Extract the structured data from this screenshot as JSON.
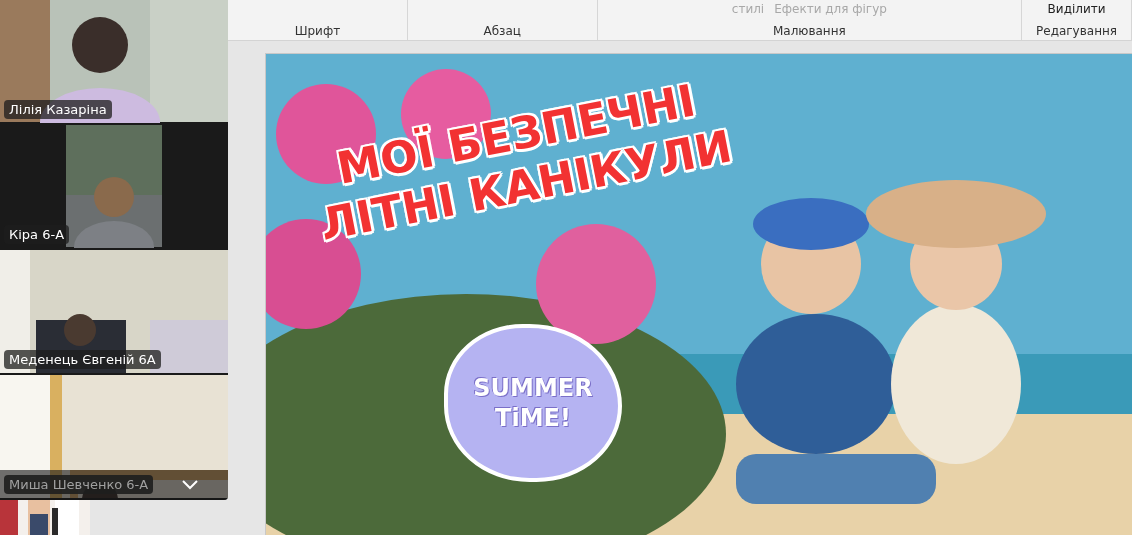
{
  "video_tiles": [
    {
      "name": "Лілія Казаріна",
      "kind": "wide",
      "dimmed": false
    },
    {
      "name": "Кіра 6-А",
      "kind": "narrow",
      "dimmed": false
    },
    {
      "name": "Меденець Євгеній 6А",
      "kind": "wide",
      "dimmed": false
    },
    {
      "name": "Миша Шевченко 6-А",
      "kind": "wide",
      "dimmed": true
    }
  ],
  "ribbon": {
    "groups": [
      {
        "label": "Шрифт"
      },
      {
        "label": "Абзац"
      },
      {
        "label": "Малювання",
        "items": [
          "стилі",
          "Ефекти для фігур"
        ]
      },
      {
        "label": "Редагування",
        "items": [
          "Виділити"
        ]
      }
    ]
  },
  "slide": {
    "title_lines": [
      "МОЇ БЕЗПЕЧНІ",
      "ЛІТНІ КАНІКУЛИ"
    ],
    "sticker_lines": [
      "SUMMER",
      "TiME!"
    ]
  }
}
